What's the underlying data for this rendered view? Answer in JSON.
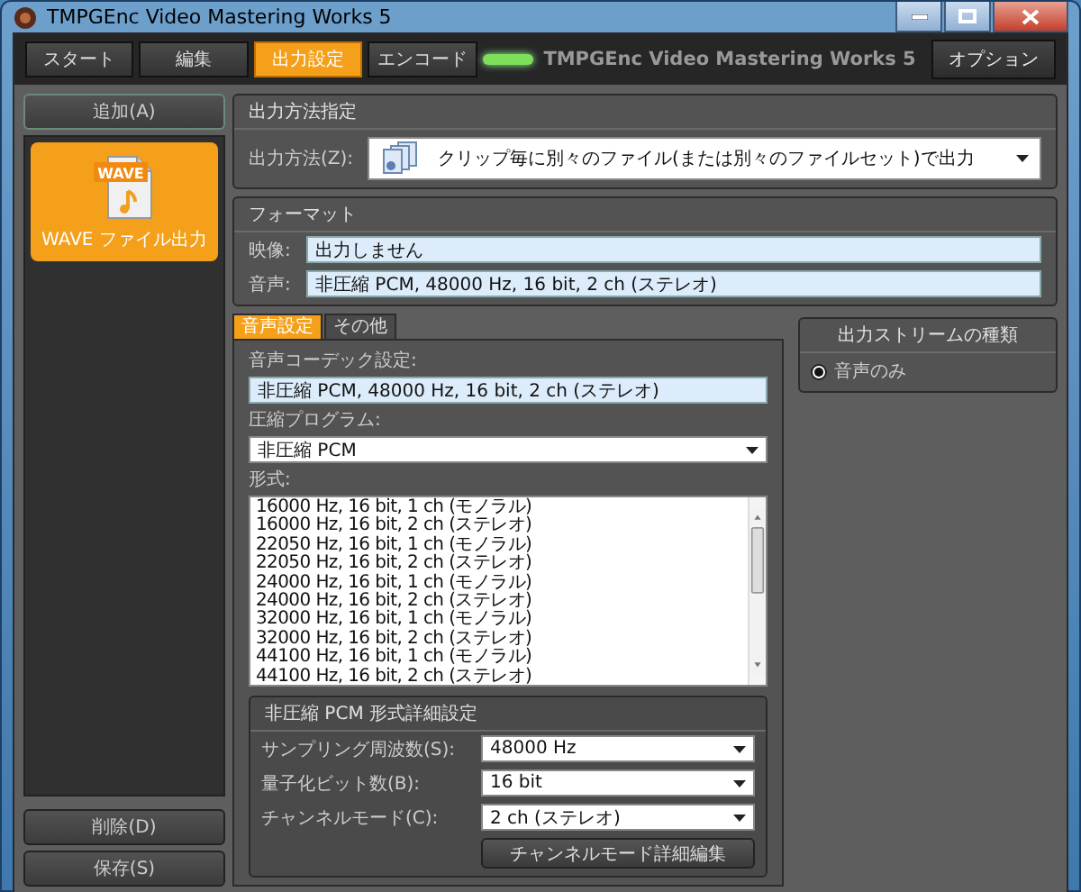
{
  "window": {
    "title": "TMPGEnc Video Mastering Works 5"
  },
  "nav_tabs": [
    {
      "label": "スタート",
      "selected": false
    },
    {
      "label": "編集",
      "selected": false
    },
    {
      "label": "出力設定",
      "selected": true
    },
    {
      "label": "エンコード",
      "selected": false
    }
  ],
  "brand": "TMPGEnc Video Mastering Works 5",
  "options_button": "オプション",
  "sidebar": {
    "add_button": "追加(A)",
    "items": [
      {
        "label": "WAVE ファイル出力",
        "icon_label": "WAVE",
        "selected": true
      }
    ],
    "delete_button": "削除(D)",
    "save_button": "保存(S)"
  },
  "output_method": {
    "title": "出力方法指定",
    "label": "出力方法(Z):",
    "value": "クリップ毎に別々のファイル(または別々のファイルセット)で出力"
  },
  "format": {
    "title": "フォーマット",
    "rows": [
      {
        "label": "映像:",
        "value": "出力しません"
      },
      {
        "label": "音声:",
        "value": "非圧縮 PCM, 48000 Hz, 16 bit, 2 ch (ステレオ)"
      }
    ]
  },
  "settings_tabs": [
    {
      "label": "音声設定",
      "selected": true
    },
    {
      "label": "その他",
      "selected": false
    }
  ],
  "audio": {
    "codec_label": "音声コーデック設定:",
    "codec_value": "非圧縮 PCM, 48000 Hz, 16 bit, 2 ch (ステレオ)",
    "program_label": "圧縮プログラム:",
    "program_value": "非圧縮 PCM",
    "format_label": "形式:",
    "formats": [
      "16000 Hz, 16 bit, 1 ch (モノラル)",
      "16000 Hz, 16 bit, 2 ch (ステレオ)",
      "22050 Hz, 16 bit, 1 ch (モノラル)",
      "22050 Hz, 16 bit, 2 ch (ステレオ)",
      "24000 Hz, 16 bit, 1 ch (モノラル)",
      "24000 Hz, 16 bit, 2 ch (ステレオ)",
      "32000 Hz, 16 bit, 1 ch (モノラル)",
      "32000 Hz, 16 bit, 2 ch (ステレオ)",
      "44100 Hz, 16 bit, 1 ch (モノラル)",
      "44100 Hz, 16 bit, 2 ch (ステレオ)"
    ],
    "detail": {
      "title": "非圧縮 PCM 形式詳細設定",
      "fields": [
        {
          "label": "サンプリング周波数(S):",
          "value": "48000 Hz"
        },
        {
          "label": "量子化ビット数(B):",
          "value": "16 bit"
        },
        {
          "label": "チャンネルモード(C):",
          "value": "2 ch (ステレオ)"
        }
      ],
      "button": "チャンネルモード詳細編集"
    }
  },
  "stream_type": {
    "title": "出力ストリームの種類",
    "options": [
      {
        "label": "音声のみ",
        "selected": true
      }
    ]
  }
}
